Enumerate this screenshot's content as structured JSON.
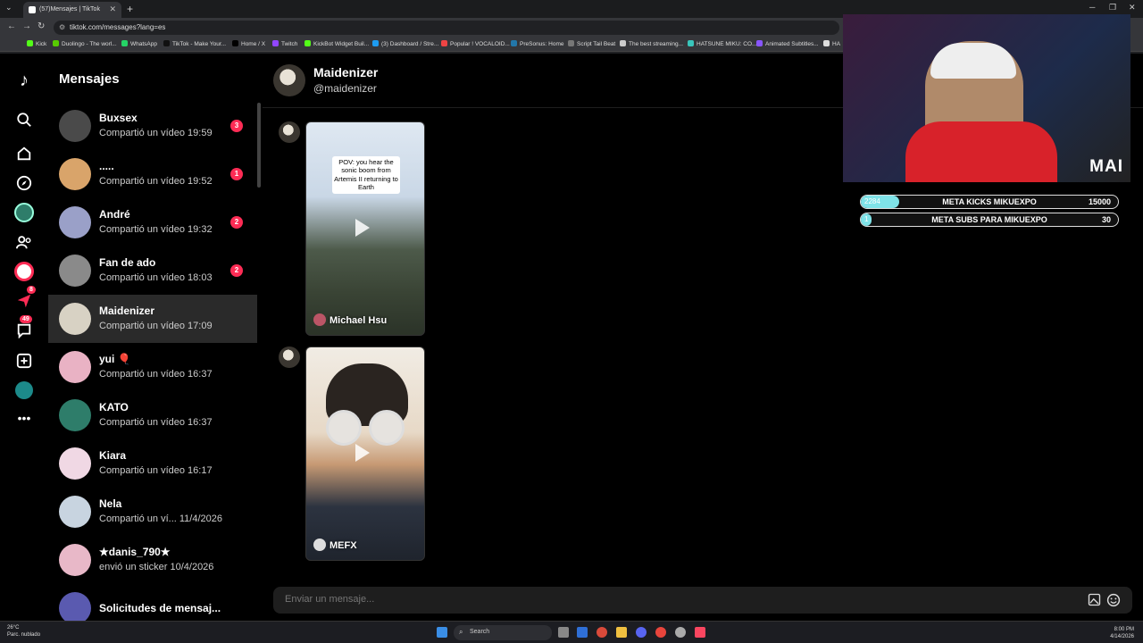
{
  "browser": {
    "tab_title": "(57)Mensajes | TikTok",
    "url": "tiktok.com/messages?lang=es",
    "bookmarks": [
      "Kick",
      "Duolingo - The worl...",
      "WhatsApp",
      "TikTok - Make Your...",
      "Home / X",
      "Twitch",
      "KickBot Widget Buil...",
      "(3) Dashboard / Stre...",
      "Popular ! VOCALOID...",
      "PreSonus: Home",
      "Script Tail Beat",
      "The best streaming...",
      "HATSUNE MIKU: CO...",
      "Animated Subtitles...",
      "HA"
    ]
  },
  "rail": {
    "notif_badge": "8",
    "inbox_badge": "49"
  },
  "sidebar": {
    "title": "Mensajes",
    "conversations": [
      {
        "name": "Buxsex",
        "sub": "Compartió un vídeo 19:59",
        "unread": "3",
        "active": false
      },
      {
        "name": ".....",
        "sub": "Compartió un vídeo 19:52",
        "unread": "1",
        "active": false
      },
      {
        "name": "André",
        "sub": "Compartió un vídeo 19:32",
        "unread": "2",
        "active": false
      },
      {
        "name": "Fan de ado",
        "sub": "Compartió un vídeo 18:03",
        "unread": "2",
        "active": false
      },
      {
        "name": "Maidenizer",
        "sub": "Compartió un vídeo 17:09",
        "unread": "",
        "active": true
      },
      {
        "name": "yui 🎈",
        "sub": "Compartió un vídeo 16:37",
        "unread": "",
        "active": false
      },
      {
        "name": "KATO",
        "sub": "Compartió un vídeo 16:37",
        "unread": "",
        "active": false
      },
      {
        "name": "Kiara",
        "sub": "Compartió un vídeo 16:17",
        "unread": "",
        "active": false
      },
      {
        "name": "Nela",
        "sub": "Compartió un ví...  11/4/2026",
        "unread": "",
        "active": false
      },
      {
        "name": "★danis_790★",
        "sub": "envió un sticker 10/4/2026",
        "unread": "",
        "active": false
      },
      {
        "name": "Solicitudes de mensaj...",
        "sub": "",
        "unread": "",
        "active": false
      }
    ],
    "avatar_colors": [
      "#4a4a4a",
      "#d9a46a",
      "#9aa0c8",
      "#8a8a8a",
      "#d8d2c4",
      "#e9b2c4",
      "#2e7d6a",
      "#f0d8e4",
      "#c8d4e0",
      "#e8b8c8",
      "#5a5ab0"
    ]
  },
  "chat": {
    "name": "Maidenizer",
    "handle": "@maidenizer",
    "timestamp_hint": "17:09",
    "messages": [
      {
        "caption": "POV: you hear the sonic boom from Artemis II returning to Earth",
        "author": "Michael Hsu"
      },
      {
        "caption": "",
        "author": "MEFX"
      }
    ],
    "composer_placeholder": "Enviar un mensaje..."
  },
  "overlay": {
    "logo": "MAI",
    "goals": [
      {
        "label": "META KICKS MIKUEXPO",
        "current": "2284",
        "target": "15000",
        "progress": 0.15
      },
      {
        "label": "META SUBS PARA MIKUEXPO",
        "current": "1",
        "target": "30",
        "progress": 0.03
      }
    ]
  },
  "taskbar": {
    "temp": "26°C",
    "weather": "Parc. nublado",
    "search": "Search",
    "time": "8:00 PM",
    "date": "4/14/2026"
  },
  "colors": {
    "accent": "#fe2c55",
    "goal_fill": "#7fe3e8"
  }
}
